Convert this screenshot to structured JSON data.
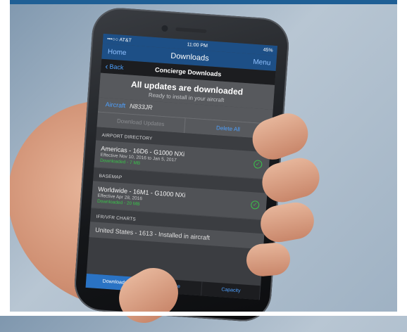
{
  "status_bar": {
    "carrier": "•••○○ AT&T",
    "time": "11:00 PM",
    "battery": "45%"
  },
  "nav": {
    "home": "Home",
    "title": "Downloads",
    "menu": "Menu"
  },
  "subnav": {
    "back": "Back",
    "title": "Concierge Downloads"
  },
  "banner": {
    "title": "All updates are downloaded",
    "subtitle": "Ready to install in your aircraft"
  },
  "aircraft": {
    "label": "Aircraft",
    "value": "N833JR"
  },
  "actions": {
    "download": "Download Updates",
    "delete": "Delete All"
  },
  "sections": [
    {
      "header": "AIRPORT DIRECTORY",
      "title": "Americas - 16D6 - G1000 NXi",
      "effective": "Effective Nov 10, 2016 to Jan 5, 2017",
      "status": "Downloaded - 7 MB"
    },
    {
      "header": "BASEMAP",
      "title": "Worldwide - 16M1 - G1000 NXi",
      "effective": "Effective Apr 28, 2016",
      "status": "Downloaded - 20 MB"
    }
  ],
  "section3": {
    "header": "IFR/VFR CHARTS",
    "partial": "United States - 1613 - Installed in aircraft"
  },
  "tabs": [
    "Downloads",
    "Queue",
    "Capacity"
  ],
  "colors": {
    "nav_blue": "#1d4f86",
    "accent_blue": "#4ea1ff",
    "success_green": "#39c24a"
  }
}
